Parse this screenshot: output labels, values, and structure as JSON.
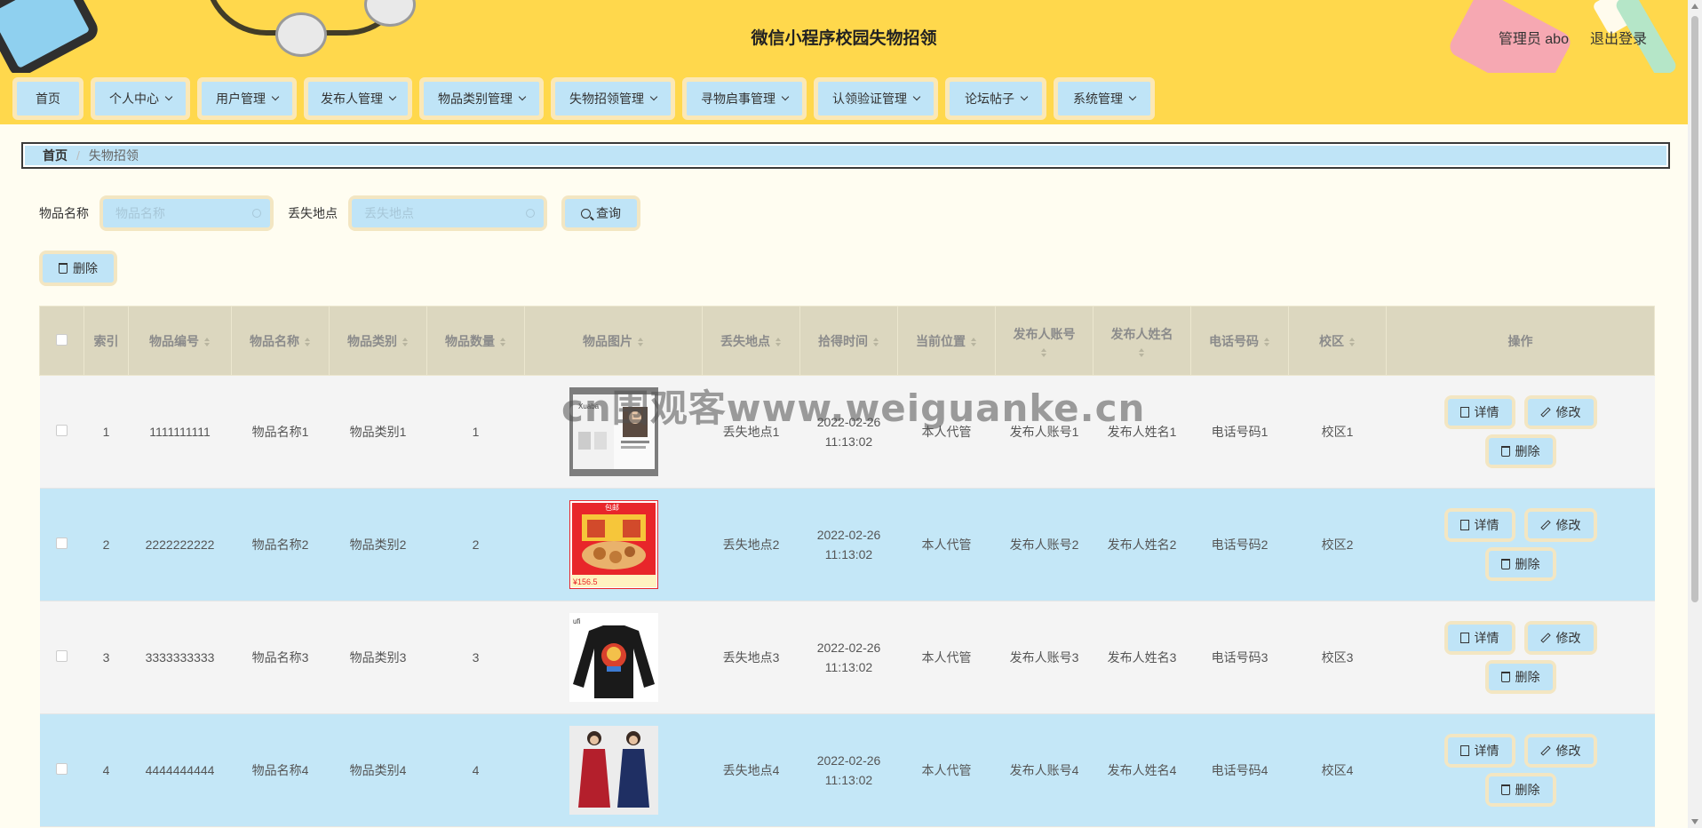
{
  "header": {
    "title": "微信小程序校园失物招领",
    "user_label": "管理员 abo",
    "logout_label": "退出登录"
  },
  "nav": [
    {
      "label": "首页",
      "dropdown": false
    },
    {
      "label": "个人中心",
      "dropdown": true
    },
    {
      "label": "用户管理",
      "dropdown": true
    },
    {
      "label": "发布人管理",
      "dropdown": true
    },
    {
      "label": "物品类别管理",
      "dropdown": true
    },
    {
      "label": "失物招领管理",
      "dropdown": true
    },
    {
      "label": "寻物启事管理",
      "dropdown": true
    },
    {
      "label": "认领验证管理",
      "dropdown": true
    },
    {
      "label": "论坛帖子",
      "dropdown": true
    },
    {
      "label": "系统管理",
      "dropdown": true
    }
  ],
  "breadcrumb": {
    "home": "首页",
    "sep": "/",
    "current": "失物招领"
  },
  "search": {
    "name_label": "物品名称",
    "name_placeholder": "物品名称",
    "place_label": "丢失地点",
    "place_placeholder": "丢失地点",
    "query_label": "查询"
  },
  "toolbar": {
    "delete_label": "删除"
  },
  "table": {
    "headers": [
      "索引",
      "物品编号",
      "物品名称",
      "物品类别",
      "物品数量",
      "物品图片",
      "丢失地点",
      "拾得时间",
      "当前位置",
      "发布人账号",
      "发布人姓名",
      "电话号码",
      "校区",
      "操作"
    ],
    "actions": {
      "detail": "详情",
      "edit": "修改",
      "delete": "删除"
    },
    "rows": [
      {
        "index": "1",
        "code": "1111111111",
        "name": "物品名称1",
        "category": "物品类别1",
        "qty": "1",
        "image": "book-photo",
        "place": "丢失地点1",
        "date": "2022-02-26",
        "time": "11:13:02",
        "location": "本人代管",
        "account": "发布人账号1",
        "publisher": "发布人姓名1",
        "phone": "电话号码1",
        "campus": "校区1"
      },
      {
        "index": "2",
        "code": "2222222222",
        "name": "物品名称2",
        "category": "物品类别2",
        "qty": "2",
        "image": "snack-box-photo",
        "place": "丢失地点2",
        "date": "2022-02-26",
        "time": "11:13:02",
        "location": "本人代管",
        "account": "发布人账号2",
        "publisher": "发布人姓名2",
        "phone": "电话号码2",
        "campus": "校区2"
      },
      {
        "index": "3",
        "code": "3333333333",
        "name": "物品名称3",
        "category": "物品类别3",
        "qty": "3",
        "image": "black-sweater-photo",
        "place": "丢失地点3",
        "date": "2022-02-26",
        "time": "11:13:02",
        "location": "本人代管",
        "account": "发布人账号3",
        "publisher": "发布人姓名3",
        "phone": "电话号码3",
        "campus": "校区3"
      },
      {
        "index": "4",
        "code": "4444444444",
        "name": "物品名称4",
        "category": "物品类别4",
        "qty": "4",
        "image": "dresses-photo",
        "place": "丢失地点4",
        "date": "2022-02-26",
        "time": "11:13:02",
        "location": "本人代管",
        "account": "发布人账号4",
        "publisher": "发布人姓名4",
        "phone": "电话号码4",
        "campus": "校区4"
      }
    ]
  },
  "watermark": "cn围观客www.weiguanke.cn",
  "thumb_text": {
    "row1": "Xuaba",
    "row2_top": "包邮",
    "row2_price": "¥156.5",
    "row3_brand": "ufi"
  },
  "colors": {
    "header_bg": "#ffd84c",
    "button_bg": "#bfe4f7",
    "button_frame": "#f3e6c2",
    "table_header": "#dcd7bf",
    "row_alt": "#c4e7f7",
    "page_bg": "#fffdf1"
  }
}
